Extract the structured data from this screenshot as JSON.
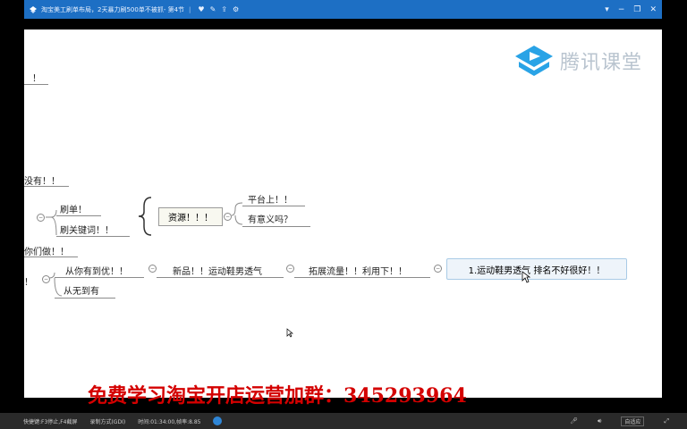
{
  "window": {
    "title": "淘宝美工刷单布局，2天暴力刷500单不被抓- 第4节",
    "separator": "|"
  },
  "mindmap": {
    "frag_top": "！",
    "frag_mid": "没有！！",
    "shuadan": "刷单！",
    "shuaguanjianci": "刷关键词！！",
    "ziyuan": "资源！！！",
    "pingtai": "平台上！！",
    "youyiyi": "有意义吗？",
    "nimen": "你们做！！",
    "congniyou": "从你有到优！！",
    "xinpin": "新品！！运动鞋男透气",
    "tuozhan": "拓展流量！！利用下！！",
    "selected_node": "1.运动鞋男透气  排名不好很好！！",
    "congwu": "从无到有",
    "frag_left": "！"
  },
  "brand": {
    "text": "腾讯课堂",
    "color": "#29a3e6"
  },
  "promo": {
    "text": "免费学习淘宝开店运营加群：345293964",
    "color": "#d40000"
  },
  "statusbar": {
    "shortcut": "快捷键:F3停止,F4截屏",
    "mode": "录制方式(GDI)",
    "time": "时间:01:34:00,帧率:8.85",
    "zoom": "自适应"
  }
}
